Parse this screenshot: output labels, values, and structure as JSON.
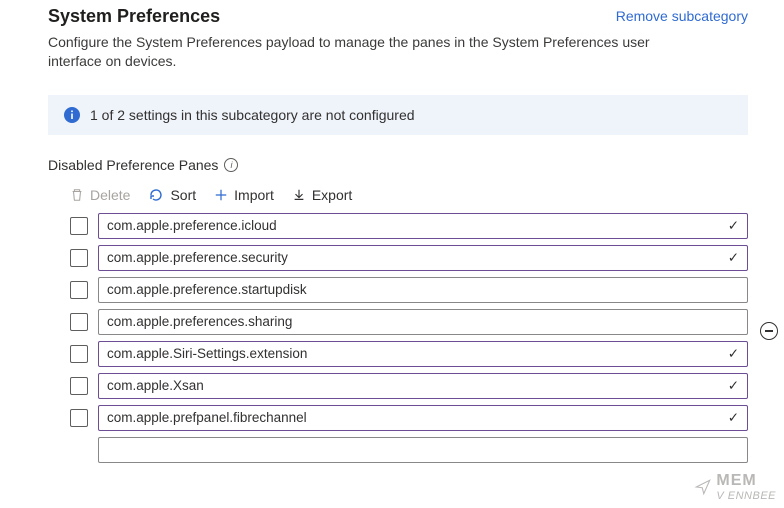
{
  "header": {
    "title": "System Preferences",
    "remove_link": "Remove subcategory",
    "description": "Configure the System Preferences payload to manage the panes in the System Preferences user interface on devices."
  },
  "banner": {
    "text": "1 of 2 settings in this subcategory are not configured"
  },
  "section": {
    "label": "Disabled Preference Panes"
  },
  "toolbar": {
    "delete": "Delete",
    "sort": "Sort",
    "import": "Import",
    "export": "Export"
  },
  "panes": [
    {
      "value": "com.apple.preference.icloud",
      "validated": true
    },
    {
      "value": "com.apple.preference.security",
      "validated": true
    },
    {
      "value": "com.apple.preference.startupdisk",
      "validated": false
    },
    {
      "value": "com.apple.preferences.sharing",
      "validated": false
    },
    {
      "value": "com.apple.Siri-Settings.extension",
      "validated": true
    },
    {
      "value": "com.apple.Xsan",
      "validated": true
    },
    {
      "value": "com.apple.prefpanel.fibrechannel",
      "validated": true
    }
  ],
  "watermark": {
    "line1": "MEM",
    "line2": "V ENNBEE"
  }
}
